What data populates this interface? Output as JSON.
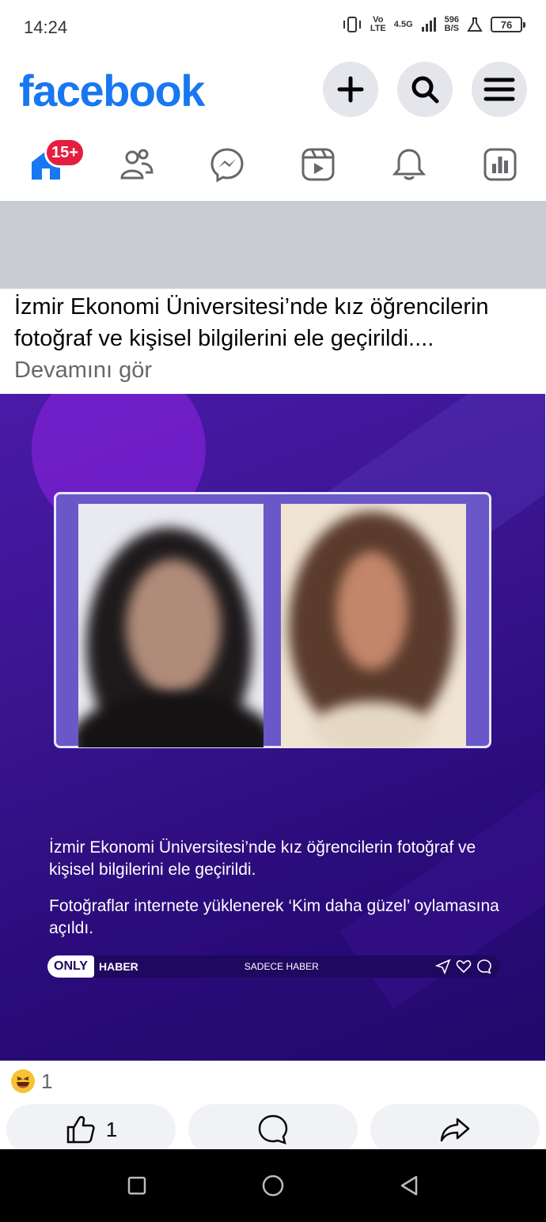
{
  "status_bar": {
    "time": "14:24",
    "network_top": "Vo",
    "network_bottom": "LTE",
    "data_type": "4.5G",
    "speed_top": "596",
    "speed_bottom": "B/S",
    "battery": "76"
  },
  "header": {
    "logo": "facebook",
    "brand_color": "#1877f2",
    "buttons": [
      "plus-icon",
      "search-icon",
      "menu-icon"
    ]
  },
  "nav": {
    "items": [
      "home-icon",
      "friends-icon",
      "messenger-icon",
      "video-icon",
      "notifications-icon",
      "dashboard-icon"
    ],
    "home_badge": "15+"
  },
  "post": {
    "caption": "İzmir Ekonomi Üniversitesi’nde kız öğrencilerin fotoğraf ve kişisel bilgilerini ele geçirildi....",
    "see_more": "Devamını gör",
    "image": {
      "headline_1": "İzmir Ekonomi Üniversitesi’nde kız öğrencilerin fotoğraf ve kişisel bilgilerini ele geçirildi.",
      "headline_2": "Fotoğraflar internete yüklenerek ‘Kim daha güzel’ oylamasına açıldı.",
      "brand_only": "ONLY",
      "brand_haber": "HABER",
      "brand_tag": "SADECE HABER"
    },
    "reactions": {
      "icon": "haha-emoji-icon",
      "count": "1"
    },
    "actions": {
      "like_count": "1"
    }
  }
}
